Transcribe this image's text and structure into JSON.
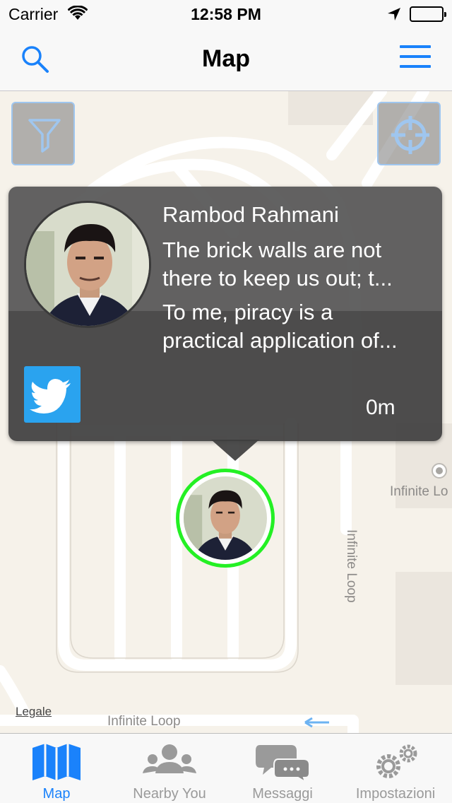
{
  "status_bar": {
    "carrier": "Carrier",
    "time": "12:58 PM"
  },
  "nav": {
    "title": "Map"
  },
  "map": {
    "labels": {
      "street_vertical": "Infinite Loop",
      "street_bottom": "Infinite Loop",
      "poi": "Infinite Lo"
    },
    "legal": "Legale"
  },
  "callout": {
    "name": "Rambod Rahmani",
    "message_1_line_1": "The brick walls are not",
    "message_1_line_2": "there to keep us out; t...",
    "message_2_line_1": "To me, piracy is a",
    "message_2_line_2": "practical application of...",
    "distance": "0m",
    "social_icon": "twitter-icon"
  },
  "tabs": [
    {
      "label": "Map",
      "icon": "map-icon",
      "active": true
    },
    {
      "label": "Nearby You",
      "icon": "people-icon",
      "active": false
    },
    {
      "label": "Messaggi",
      "icon": "chat-bubbles-icon",
      "active": false
    },
    {
      "label": "Impostazioni",
      "icon": "gears-icon",
      "active": false
    }
  ],
  "colors": {
    "accent": "#1a82fb",
    "pin_ring": "#24f024",
    "twitter": "#2aa3ef",
    "callout_bg": "#3e3e3e",
    "map_bg": "#f6f2ea"
  }
}
